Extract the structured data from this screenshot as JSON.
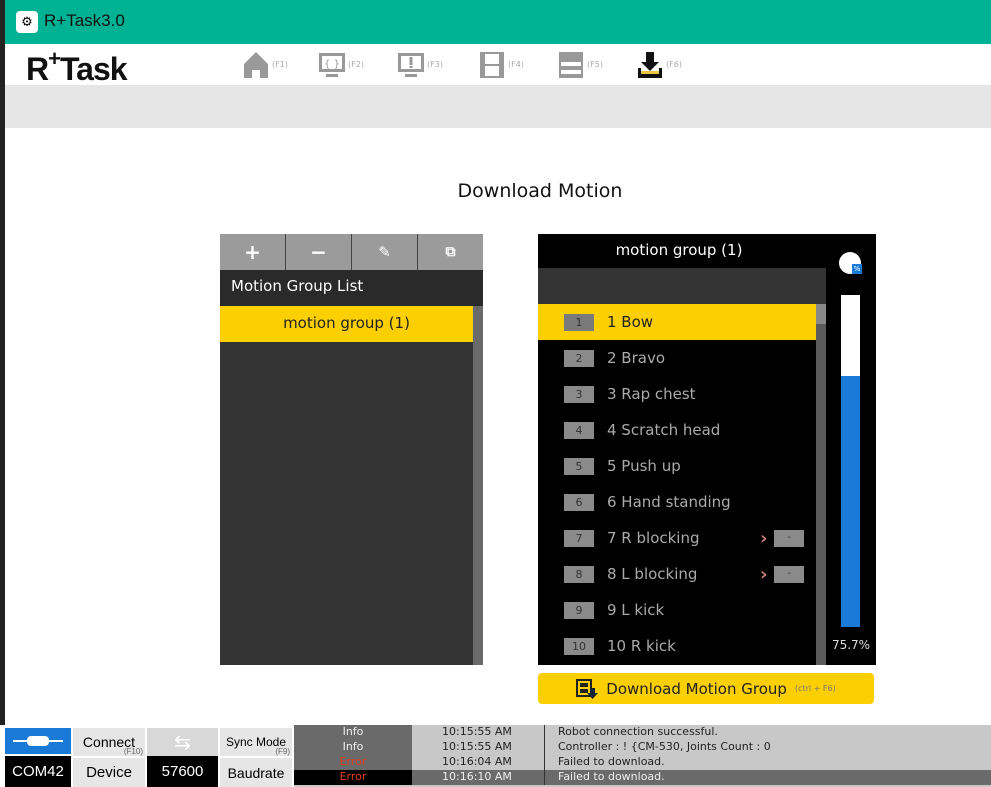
{
  "window": {
    "title": "R+Task3.0"
  },
  "logo": {
    "text": "R+Task"
  },
  "toolbar": [
    {
      "icon": "home-icon",
      "key": "(F1)"
    },
    {
      "icon": "code-monitor-icon",
      "key": "(F2)"
    },
    {
      "icon": "alert-monitor-icon",
      "key": "(F3)"
    },
    {
      "icon": "film-icon",
      "key": "(F4)"
    },
    {
      "icon": "clapper-icon",
      "key": "(F5)"
    },
    {
      "icon": "download-icon",
      "key": "(F6)",
      "active": true
    }
  ],
  "page": {
    "title": "Download Motion"
  },
  "group_panel": {
    "tools": [
      "+",
      "−",
      "✎",
      "⧉"
    ],
    "heading": "Motion Group List",
    "items": [
      "motion group (1)"
    ]
  },
  "motion_panel": {
    "title": "motion group (1)",
    "items": [
      {
        "num": "1",
        "label": "1 Bow"
      },
      {
        "num": "2",
        "label": "2 Bravo"
      },
      {
        "num": "3",
        "label": "3 Rap chest"
      },
      {
        "num": "4",
        "label": "4 Scratch head"
      },
      {
        "num": "5",
        "label": "5 Push up"
      },
      {
        "num": "6",
        "label": "6 Hand standing"
      },
      {
        "num": "7",
        "label": "7 R blocking",
        "link": "-"
      },
      {
        "num": "8",
        "label": "8 L blocking",
        "link": "-"
      },
      {
        "num": "9",
        "label": "9 L kick"
      },
      {
        "num": "10",
        "label": "10 R kick"
      }
    ],
    "memory_percent": 75.7,
    "memory_label": "75.7%",
    "pct_icon": "%"
  },
  "download_button": {
    "label": "Download Motion Group",
    "shortcut": "(ctrl + F6)"
  },
  "statusbar": {
    "connect": "Connect",
    "connect_key": "(F10)",
    "sync": "Sync Mode",
    "sync_key": "(F9)",
    "port": "COM42",
    "device": "Device",
    "baud": "57600",
    "baudrate": "Baudrate"
  },
  "log": [
    {
      "type": "Info",
      "time": "10:15:55 AM",
      "msg": "Robot connection successful."
    },
    {
      "type": "Info",
      "time": "10:15:55 AM",
      "msg": "Controller : !  {CM-530, Joints Count : 0"
    },
    {
      "type": "Error",
      "time": "10:16:04 AM",
      "msg": "Failed to download."
    },
    {
      "type": "Error",
      "time": "10:16:10 AM",
      "msg": "Failed to download."
    }
  ],
  "colors": {
    "titlebar": "#00b294",
    "accent": "#fccf00",
    "progress": "#1a7ad8",
    "error": "#e0401a"
  }
}
